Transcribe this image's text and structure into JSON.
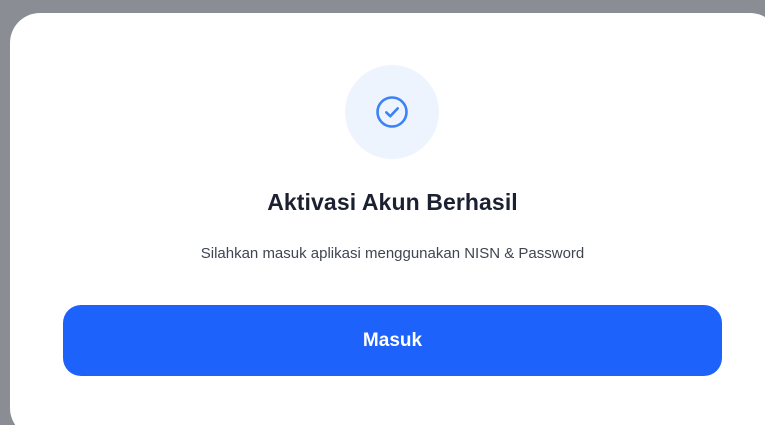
{
  "dialog": {
    "icon": "check-circle-icon",
    "title": "Aktivasi Akun Berhasil",
    "message": "Silahkan masuk aplikasi menggunakan NISN & Password",
    "primary_button_label": "Masuk"
  },
  "colors": {
    "accent": "#1c62fb",
    "icon_background": "#eef4fe",
    "icon_stroke": "#3b82f6",
    "title_text": "#1b2130",
    "body_text": "#3f4652",
    "overlay": "#8a8d94"
  }
}
